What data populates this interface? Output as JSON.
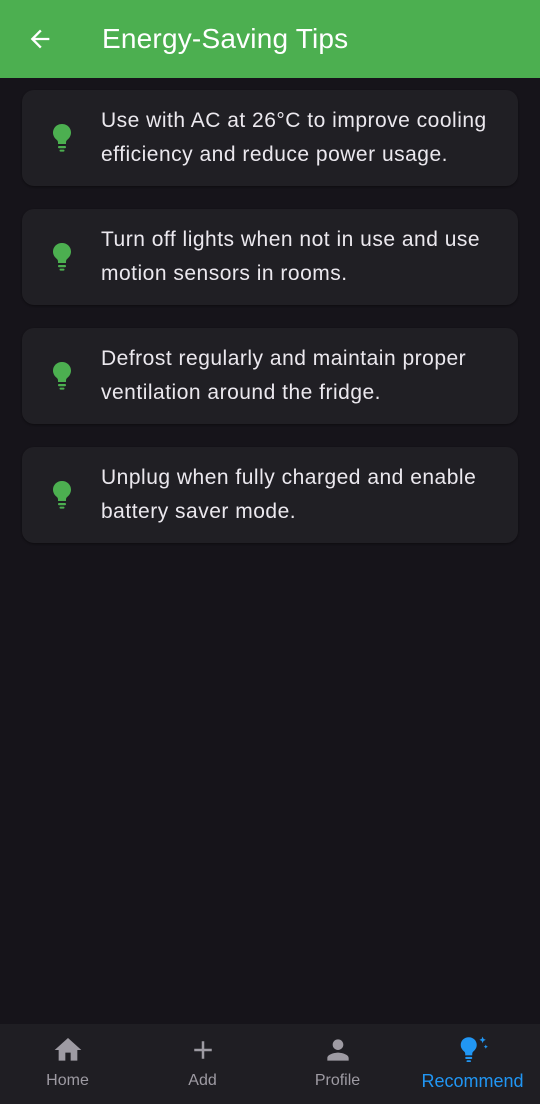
{
  "appbar": {
    "title": "Energy-Saving Tips",
    "back_icon": "arrow-back-icon",
    "color": "#4caf50"
  },
  "tips": [
    {
      "icon": "lightbulb-icon",
      "text": "Use with AC at 26°C to improve cooling efficiency and reduce power usage."
    },
    {
      "icon": "lightbulb-icon",
      "text": "Turn off lights when not in use and use motion sensors in rooms."
    },
    {
      "icon": "lightbulb-icon",
      "text": "Defrost regularly and maintain proper ventilation around the fridge."
    },
    {
      "icon": "lightbulb-icon",
      "text": "Unplug when fully charged and enable battery saver mode."
    }
  ],
  "bottom_nav": {
    "items": [
      {
        "label": "Home",
        "icon": "home-icon"
      },
      {
        "label": "Add",
        "icon": "plus-icon"
      },
      {
        "label": "Profile",
        "icon": "person-icon"
      },
      {
        "label": "Recommend",
        "icon": "lightbulb-sparkle-icon",
        "active": true
      }
    ],
    "active_color": "#2196f3"
  },
  "colors": {
    "background": "#16141a",
    "card": "#201f24",
    "tip_icon": "#4caf50"
  }
}
